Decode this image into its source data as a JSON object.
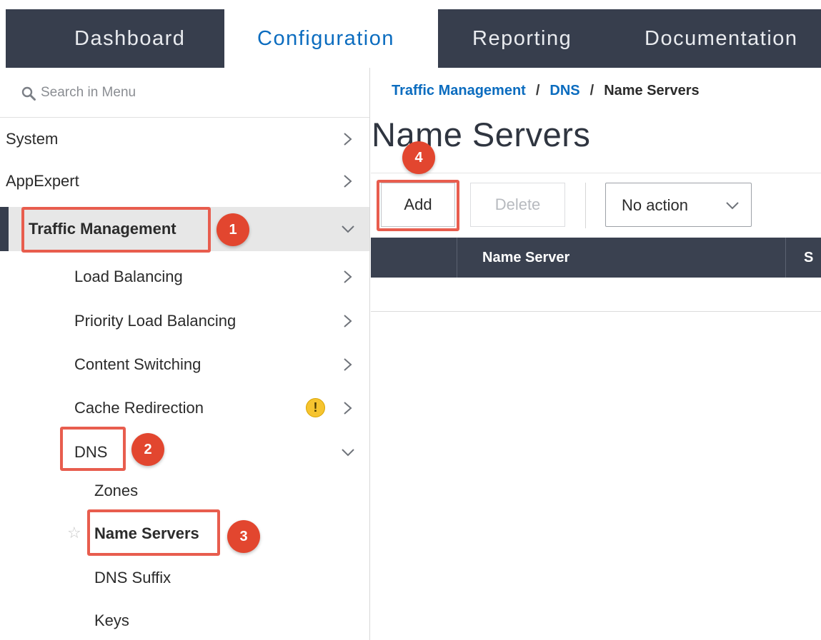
{
  "top_nav": {
    "tabs": [
      {
        "label": "Dashboard"
      },
      {
        "label": "Configuration",
        "active": true
      },
      {
        "label": "Reporting"
      },
      {
        "label": "Documentation"
      }
    ]
  },
  "sidebar": {
    "search_placeholder": "Search in Menu",
    "items": [
      {
        "label": "System"
      },
      {
        "label": "AppExpert"
      },
      {
        "label": "Traffic Management",
        "expanded": true,
        "selected": true
      },
      {
        "label": "Load Balancing"
      },
      {
        "label": "Priority Load Balancing"
      },
      {
        "label": "Content Switching"
      },
      {
        "label": "Cache Redirection",
        "warning": "!"
      },
      {
        "label": "DNS",
        "expanded": true
      },
      {
        "label": "Zones"
      },
      {
        "label": "Name Servers",
        "current": true
      },
      {
        "label": "DNS Suffix"
      },
      {
        "label": "Keys"
      }
    ]
  },
  "annotations": {
    "badges": [
      "1",
      "2",
      "3",
      "4"
    ]
  },
  "main": {
    "breadcrumb": {
      "items": [
        "Traffic Management",
        "DNS"
      ],
      "current": "Name Servers",
      "separator": "/"
    },
    "title": "Name Servers",
    "toolbar": {
      "add_label": "Add",
      "delete_label": "Delete",
      "action_select_value": "No action"
    },
    "table": {
      "columns": [
        "Name Server",
        "S"
      ]
    }
  },
  "colors": {
    "nav_dark": "#373e4d",
    "accent_blue": "#0b6cbf",
    "annotation_red": "#e2462f",
    "warning_yellow": "#f6c42f"
  }
}
